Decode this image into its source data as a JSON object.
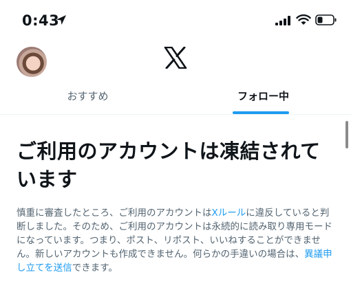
{
  "status_bar": {
    "time": "0:43",
    "icons": [
      "location-arrow-icon",
      "cellular-signal-icon",
      "wifi-icon",
      "battery-icon"
    ]
  },
  "header": {
    "logo": "x-logo-icon",
    "avatar": "user-avatar"
  },
  "tabs": [
    {
      "label": "おすすめ",
      "active": false
    },
    {
      "label": "フォロー中",
      "active": true
    }
  ],
  "notice": {
    "headline": "ご利用のアカウントは凍結されています",
    "body_part1": "慎重に審査したところ、ご利用のアカウントは",
    "x_rules_link": "Xルール",
    "body_part2": "に違反していると判断しました。そのため、ご利用のアカウントは永続的に読み取り専用モードになっています。つまり、ポスト、リポスト、いいねすることができません。新しいアカウントも作成できません。何らかの手違いの場合は、",
    "appeal_link": "異議申し立てを送信",
    "body_part3": "できます。"
  },
  "colors": {
    "accent": "#1d9bf0",
    "text_primary": "#0f1419",
    "text_secondary": "#536471"
  }
}
